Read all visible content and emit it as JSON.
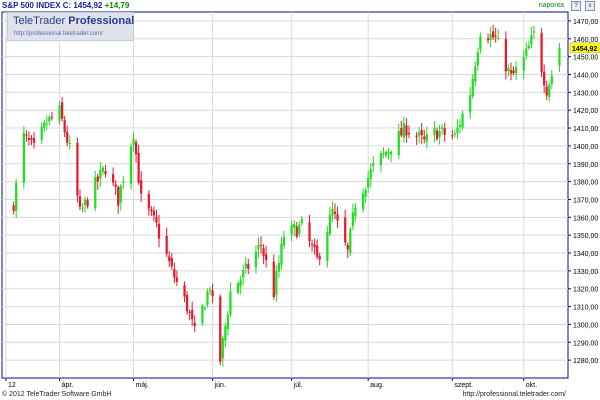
{
  "header": {
    "title": "S&P 500 INDEX C: 1454,92",
    "change": "+14,79",
    "period": "naponta",
    "buttons": [
      "?",
      "x"
    ]
  },
  "logo": {
    "brand": "TeleTrader",
    "pro": "Professional",
    "url": "http://professional.teletrader.com/"
  },
  "footer": {
    "copyright": "© 2012 TeleTrader Software GmbH",
    "link": "http://professional.teletrader.com/"
  },
  "colors": {
    "up": "#22dd22",
    "down": "#e8192c",
    "grid": "#d9d9d9",
    "axis": "#0a0a8c",
    "price_tag": "#ffff00"
  },
  "chart_data": {
    "type": "candlestick",
    "title": "S&P 500 INDEX",
    "last_price_label": "1454,92",
    "y_ticks": [
      "1280,00",
      "1290,00",
      "1300,00",
      "1310,00",
      "1320,00",
      "1330,00",
      "1340,00",
      "1350,00",
      "1360,00",
      "1370,00",
      "1380,00",
      "1390,00",
      "1400,00",
      "1410,00",
      "1420,00",
      "1430,00",
      "1440,00",
      "1450,00",
      "1460,00",
      "1470,00"
    ],
    "ylim": [
      1270,
      1475
    ],
    "x_ticks": [
      "12",
      "ápr.",
      "máj.",
      "jún.",
      "júl.",
      "aug.",
      "szept.",
      "okt."
    ],
    "grid": true,
    "series": [
      {
        "date": "2012-03-15",
        "value": 1368
      },
      {
        "date": "2012-03-19",
        "value": 1405
      },
      {
        "date": "2012-03-23",
        "value": 1398
      },
      {
        "date": "2012-03-28",
        "value": 1413
      },
      {
        "date": "2012-04-02",
        "value": 1419
      },
      {
        "date": "2012-04-06",
        "value": 1398
      },
      {
        "date": "2012-04-10",
        "value": 1362
      },
      {
        "date": "2012-04-16",
        "value": 1378
      },
      {
        "date": "2012-04-20",
        "value": 1388
      },
      {
        "date": "2012-04-25",
        "value": 1370
      },
      {
        "date": "2012-05-01",
        "value": 1408
      },
      {
        "date": "2012-05-04",
        "value": 1370
      },
      {
        "date": "2012-05-10",
        "value": 1355
      },
      {
        "date": "2012-05-16",
        "value": 1330
      },
      {
        "date": "2012-05-22",
        "value": 1310
      },
      {
        "date": "2012-05-25",
        "value": 1295
      },
      {
        "date": "2012-05-31",
        "value": 1322
      },
      {
        "date": "2012-06-04",
        "value": 1280
      },
      {
        "date": "2012-06-08",
        "value": 1318
      },
      {
        "date": "2012-06-14",
        "value": 1330
      },
      {
        "date": "2012-06-20",
        "value": 1345
      },
      {
        "date": "2012-06-25",
        "value": 1318
      },
      {
        "date": "2012-06-29",
        "value": 1350
      },
      {
        "date": "2012-07-06",
        "value": 1355
      },
      {
        "date": "2012-07-12",
        "value": 1336
      },
      {
        "date": "2012-07-18",
        "value": 1363
      },
      {
        "date": "2012-07-24",
        "value": 1340
      },
      {
        "date": "2012-07-27",
        "value": 1368
      },
      {
        "date": "2012-08-03",
        "value": 1388
      },
      {
        "date": "2012-08-10",
        "value": 1400
      },
      {
        "date": "2012-08-16",
        "value": 1410
      },
      {
        "date": "2012-08-23",
        "value": 1402
      },
      {
        "date": "2012-08-28",
        "value": 1408
      },
      {
        "date": "2012-09-04",
        "value": 1405
      },
      {
        "date": "2012-09-10",
        "value": 1430
      },
      {
        "date": "2012-09-14",
        "value": 1465
      },
      {
        "date": "2012-09-20",
        "value": 1460
      },
      {
        "date": "2012-09-26",
        "value": 1438
      },
      {
        "date": "2012-10-01",
        "value": 1448
      },
      {
        "date": "2012-10-05",
        "value": 1462
      },
      {
        "date": "2012-10-10",
        "value": 1432
      },
      {
        "date": "2012-10-12",
        "value": 1440
      },
      {
        "date": "2012-10-15",
        "value": 1454.92
      }
    ]
  }
}
